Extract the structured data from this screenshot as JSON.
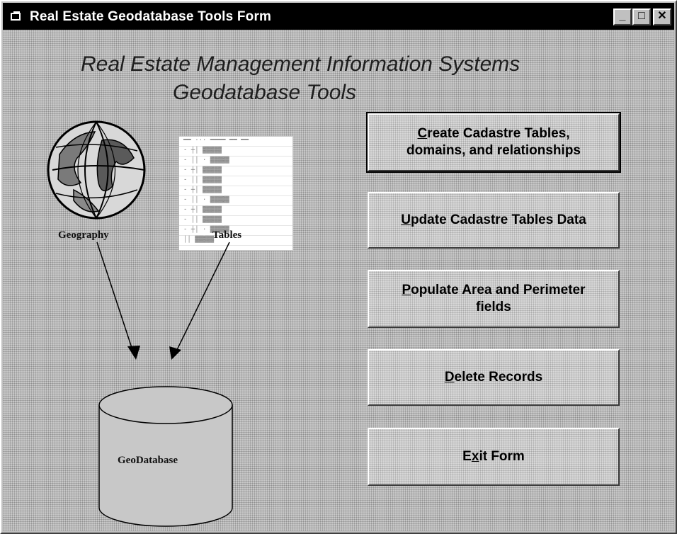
{
  "window": {
    "title": "Real Estate Geodatabase Tools Form"
  },
  "header": {
    "line1": "Real Estate Management Information Systems",
    "line2": "Geodatabase Tools"
  },
  "diagram": {
    "geography_label": "Geography",
    "tables_label": "Tables",
    "database_label": "GeoDatabase"
  },
  "buttons": [
    {
      "mnemonic": "C",
      "pre": "",
      "rest": "reate Cadastre Tables,",
      "line2": "domains, and relationships"
    },
    {
      "mnemonic": "U",
      "pre": "",
      "rest": "pdate Cadastre Tables Data",
      "line2": ""
    },
    {
      "mnemonic": "P",
      "pre": "",
      "rest": "opulate Area and Perimeter",
      "line2": "fields"
    },
    {
      "mnemonic": "D",
      "pre": "",
      "rest": "elete Records",
      "line2": ""
    },
    {
      "mnemonic": "x",
      "pre": "E",
      "rest": "it Form",
      "line2": ""
    }
  ],
  "icons": {
    "app": "app-icon",
    "minimize": "minimize-icon",
    "maximize": "maximize-icon",
    "close": "close-icon"
  }
}
